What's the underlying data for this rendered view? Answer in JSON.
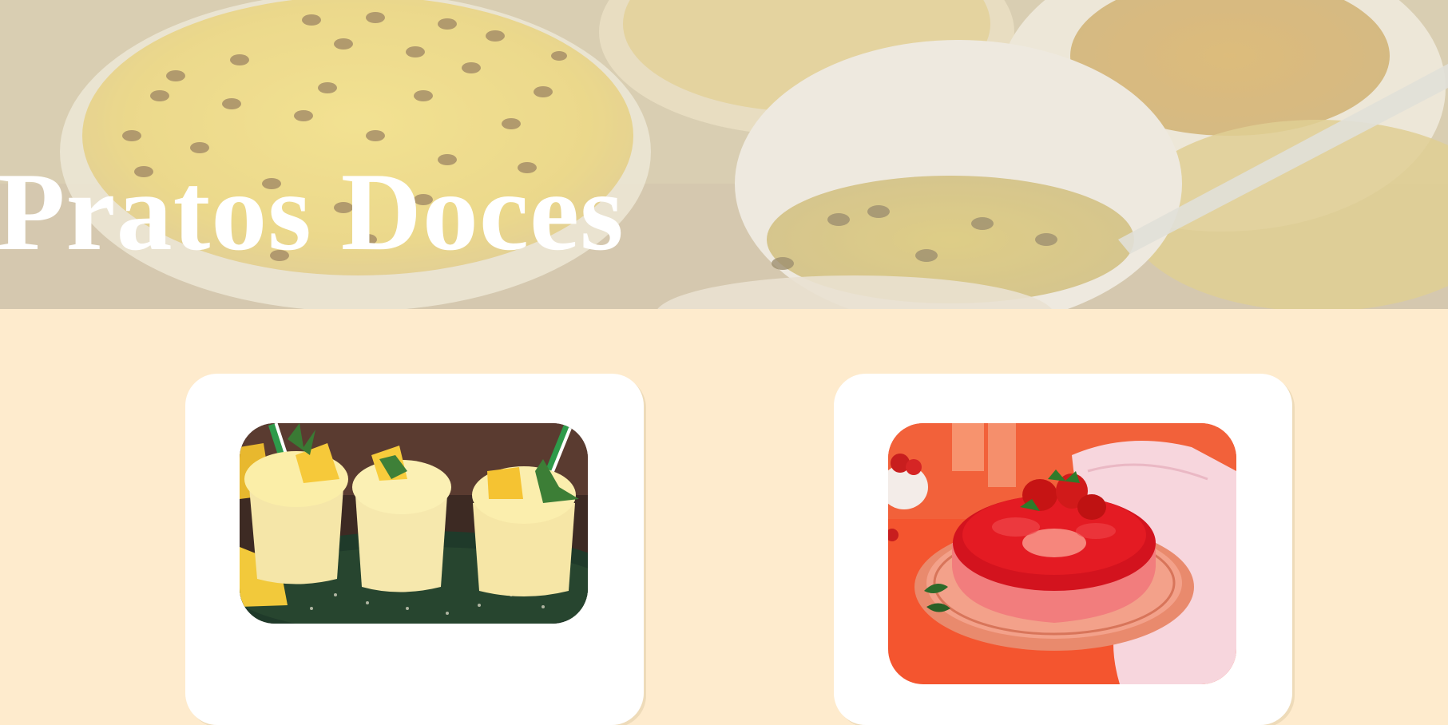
{
  "hero": {
    "title": "Pratos Doces",
    "image": "passion-fruit-mousse-bowls-photo"
  },
  "cards": [
    {
      "image": "pineapple-mousse-cups-photo",
      "caption": ""
    },
    {
      "image": "strawberry-gelatin-ring-cake-photo",
      "caption": ""
    }
  ],
  "colors": {
    "page_background": "#feebcd",
    "card_background": "#ffffff",
    "title_color": "#ffffff"
  }
}
